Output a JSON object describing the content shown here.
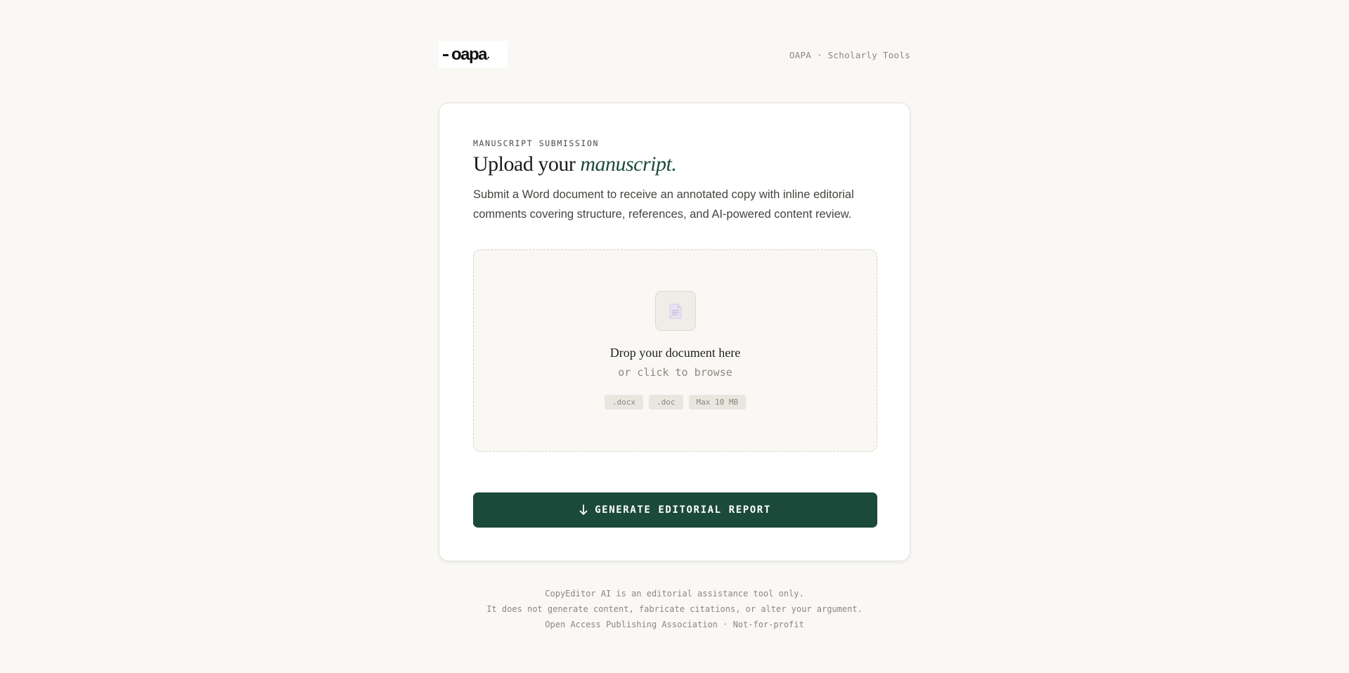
{
  "header": {
    "logo_text": "oapa",
    "logo_dot": ".",
    "tagline": "OAPA · Scholarly Tools"
  },
  "card": {
    "eyebrow": "MANUSCRIPT SUBMISSION",
    "title_prefix": "Upload your",
    "title_accent": "manuscript.",
    "subtitle": "Submit a Word document to receive an annotated copy with inline editorial comments covering structure, references, and AI-powered content review."
  },
  "dropzone": {
    "icon": "document-icon",
    "title": "Drop your document here",
    "subtitle": "or click to browse",
    "chips": [
      ".docx",
      ".doc",
      "Max 10 MB"
    ]
  },
  "generate_button": {
    "icon": "arrow-down-icon",
    "label": "GENERATE EDITORIAL REPORT"
  },
  "footer": {
    "line1": "CopyEditor AI is an editorial assistance tool only.",
    "line2": "It does not generate content, fabricate citations, or alter your argument.",
    "line3": "Open Access Publishing Association · Not-for-profit"
  },
  "colors": {
    "background": "#f9f8f5",
    "accent": "#1b4a3b",
    "card": "#ffffff"
  }
}
